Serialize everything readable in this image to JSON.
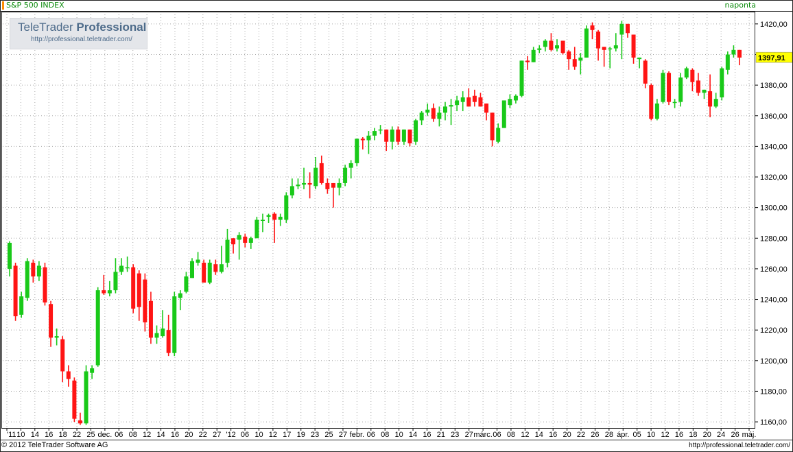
{
  "header": {
    "title": "S&P 500 INDEX",
    "frequency": "naponta"
  },
  "watermark": {
    "brand_prefix": "TeleTrader ",
    "brand_bold": "Professional",
    "url": "http://professional.teletrader.com/"
  },
  "footer": {
    "copyright": "© 2012  TeleTrader Software AG",
    "url": "http://professional.teletrader.com/"
  },
  "colors": {
    "up": "#19c919",
    "down": "#ff1414",
    "grid": "#a8a8a8",
    "frame": "#222222",
    "last_price_bg": "#ffff00"
  },
  "chart_data": {
    "type": "candlestick",
    "title": "S&P 500 INDEX",
    "ylim": [
      1156,
      1428
    ],
    "y_ticks": [
      "1160,00",
      "1180,00",
      "1200,00",
      "1220,00",
      "1240,00",
      "1260,00",
      "1280,00",
      "1300,00",
      "1320,00",
      "1340,00",
      "1360,00",
      "1380,00",
      "1400,00",
      "1420,00"
    ],
    "last_price": "1397,91",
    "last_price_value": 1397.91,
    "x_labels": [
      "'11",
      "10",
      "14",
      "16",
      "18",
      "22",
      "25",
      "dec.",
      "06",
      "08",
      "12",
      "14",
      "16",
      "20",
      "22",
      "27",
      "'12",
      "06",
      "10",
      "12",
      "17",
      "19",
      "23",
      "25",
      "27",
      "febr.",
      "06",
      "08",
      "10",
      "14",
      "16",
      "21",
      "23",
      "27",
      "márc.",
      "06",
      "08",
      "12",
      "14",
      "16",
      "20",
      "22",
      "26",
      "28",
      "ápr.",
      "05",
      "10",
      "12",
      "16",
      "18",
      "20",
      "24",
      "26",
      "máj."
    ],
    "grid": true,
    "candles": [
      {
        "o": 1260,
        "h": 1278,
        "l": 1255,
        "c": 1277
      },
      {
        "o": 1262,
        "h": 1264,
        "l": 1226,
        "c": 1229
      },
      {
        "o": 1230,
        "h": 1245,
        "l": 1228,
        "c": 1242
      },
      {
        "o": 1241,
        "h": 1267,
        "l": 1239,
        "c": 1265
      },
      {
        "o": 1264,
        "h": 1266,
        "l": 1251,
        "c": 1255
      },
      {
        "o": 1255,
        "h": 1265,
        "l": 1252,
        "c": 1262
      },
      {
        "o": 1261,
        "h": 1264,
        "l": 1236,
        "c": 1238
      },
      {
        "o": 1237,
        "h": 1239,
        "l": 1209,
        "c": 1215
      },
      {
        "o": 1215,
        "h": 1221,
        "l": 1210,
        "c": 1216
      },
      {
        "o": 1214,
        "h": 1216,
        "l": 1186,
        "c": 1193
      },
      {
        "o": 1193,
        "h": 1197,
        "l": 1183,
        "c": 1188
      },
      {
        "o": 1187,
        "h": 1189,
        "l": 1160,
        "c": 1162
      },
      {
        "o": 1161,
        "h": 1166,
        "l": 1158,
        "c": 1159
      },
      {
        "o": 1159,
        "h": 1197,
        "l": 1158,
        "c": 1193
      },
      {
        "o": 1192,
        "h": 1197,
        "l": 1188,
        "c": 1195
      },
      {
        "o": 1197,
        "h": 1248,
        "l": 1196,
        "c": 1246
      },
      {
        "o": 1246,
        "h": 1256,
        "l": 1243,
        "c": 1244
      },
      {
        "o": 1244,
        "h": 1252,
        "l": 1242,
        "c": 1246
      },
      {
        "o": 1246,
        "h": 1267,
        "l": 1244,
        "c": 1258
      },
      {
        "o": 1258,
        "h": 1267,
        "l": 1256,
        "c": 1262
      },
      {
        "o": 1261,
        "h": 1268,
        "l": 1258,
        "c": 1261
      },
      {
        "o": 1261,
        "h": 1263,
        "l": 1231,
        "c": 1234
      },
      {
        "o": 1257,
        "h": 1259,
        "l": 1226,
        "c": 1235
      },
      {
        "o": 1253,
        "h": 1257,
        "l": 1219,
        "c": 1225
      },
      {
        "o": 1239,
        "h": 1245,
        "l": 1211,
        "c": 1215
      },
      {
        "o": 1215,
        "h": 1223,
        "l": 1211,
        "c": 1218
      },
      {
        "o": 1216,
        "h": 1233,
        "l": 1215,
        "c": 1221
      },
      {
        "o": 1220,
        "h": 1230,
        "l": 1203,
        "c": 1205
      },
      {
        "o": 1205,
        "h": 1245,
        "l": 1203,
        "c": 1242
      },
      {
        "o": 1241,
        "h": 1246,
        "l": 1233,
        "c": 1244
      },
      {
        "o": 1245,
        "h": 1258,
        "l": 1244,
        "c": 1255
      },
      {
        "o": 1254,
        "h": 1267,
        "l": 1254,
        "c": 1265
      },
      {
        "o": 1264,
        "h": 1271,
        "l": 1262,
        "c": 1266
      },
      {
        "o": 1264,
        "h": 1266,
        "l": 1251,
        "c": 1251
      },
      {
        "o": 1251,
        "h": 1266,
        "l": 1250,
        "c": 1264
      },
      {
        "o": 1263,
        "h": 1266,
        "l": 1256,
        "c": 1258
      },
      {
        "o": 1258,
        "h": 1275,
        "l": 1257,
        "c": 1263
      },
      {
        "o": 1264,
        "h": 1286,
        "l": 1261,
        "c": 1279
      },
      {
        "o": 1280,
        "h": 1280,
        "l": 1270,
        "c": 1276
      },
      {
        "o": 1279,
        "h": 1284,
        "l": 1266,
        "c": 1282
      },
      {
        "o": 1281,
        "h": 1283,
        "l": 1274,
        "c": 1277
      },
      {
        "o": 1277,
        "h": 1281,
        "l": 1273,
        "c": 1280
      },
      {
        "o": 1280,
        "h": 1294,
        "l": 1280,
        "c": 1292
      },
      {
        "o": 1292,
        "h": 1296,
        "l": 1284,
        "c": 1292
      },
      {
        "o": 1294,
        "h": 1296,
        "l": 1290,
        "c": 1295
      },
      {
        "o": 1296,
        "h": 1297,
        "l": 1277,
        "c": 1292
      },
      {
        "o": 1292,
        "h": 1296,
        "l": 1288,
        "c": 1294
      },
      {
        "o": 1292,
        "h": 1310,
        "l": 1290,
        "c": 1308
      },
      {
        "o": 1308,
        "h": 1319,
        "l": 1306,
        "c": 1314
      },
      {
        "o": 1314,
        "h": 1319,
        "l": 1312,
        "c": 1315
      },
      {
        "o": 1315,
        "h": 1326,
        "l": 1312,
        "c": 1316
      },
      {
        "o": 1316,
        "h": 1323,
        "l": 1306,
        "c": 1315
      },
      {
        "o": 1314,
        "h": 1333,
        "l": 1312,
        "c": 1326
      },
      {
        "o": 1329,
        "h": 1334,
        "l": 1315,
        "c": 1316
      },
      {
        "o": 1316,
        "h": 1319,
        "l": 1309,
        "c": 1312
      },
      {
        "o": 1316,
        "h": 1316,
        "l": 1300,
        "c": 1313
      },
      {
        "o": 1313,
        "h": 1319,
        "l": 1308,
        "c": 1316
      },
      {
        "o": 1316,
        "h": 1328,
        "l": 1314,
        "c": 1326
      },
      {
        "o": 1326,
        "h": 1331,
        "l": 1319,
        "c": 1329
      },
      {
        "o": 1329,
        "h": 1345,
        "l": 1327,
        "c": 1345
      },
      {
        "o": 1345,
        "h": 1346,
        "l": 1338,
        "c": 1344
      },
      {
        "o": 1344,
        "h": 1350,
        "l": 1335,
        "c": 1347
      },
      {
        "o": 1347,
        "h": 1352,
        "l": 1344,
        "c": 1350
      },
      {
        "o": 1351,
        "h": 1354,
        "l": 1348,
        "c": 1351
      },
      {
        "o": 1351,
        "h": 1351,
        "l": 1337,
        "c": 1343
      },
      {
        "o": 1343,
        "h": 1353,
        "l": 1338,
        "c": 1351
      },
      {
        "o": 1351,
        "h": 1353,
        "l": 1341,
        "c": 1343
      },
      {
        "o": 1343,
        "h": 1351,
        "l": 1341,
        "c": 1351
      },
      {
        "o": 1351,
        "h": 1351,
        "l": 1340,
        "c": 1342
      },
      {
        "o": 1343,
        "h": 1358,
        "l": 1341,
        "c": 1357
      },
      {
        "o": 1357,
        "h": 1363,
        "l": 1354,
        "c": 1362
      },
      {
        "o": 1362,
        "h": 1368,
        "l": 1360,
        "c": 1364
      },
      {
        "o": 1365,
        "h": 1368,
        "l": 1356,
        "c": 1358
      },
      {
        "o": 1358,
        "h": 1366,
        "l": 1353,
        "c": 1362
      },
      {
        "o": 1362,
        "h": 1369,
        "l": 1357,
        "c": 1366
      },
      {
        "o": 1366,
        "h": 1371,
        "l": 1354,
        "c": 1367
      },
      {
        "o": 1367,
        "h": 1373,
        "l": 1363,
        "c": 1370
      },
      {
        "o": 1369,
        "h": 1376,
        "l": 1363,
        "c": 1372
      },
      {
        "o": 1372,
        "h": 1378,
        "l": 1366,
        "c": 1366
      },
      {
        "o": 1373,
        "h": 1377,
        "l": 1366,
        "c": 1369
      },
      {
        "o": 1372,
        "h": 1375,
        "l": 1366,
        "c": 1366
      },
      {
        "o": 1368,
        "h": 1368,
        "l": 1357,
        "c": 1362
      },
      {
        "o": 1362,
        "h": 1362,
        "l": 1340,
        "c": 1344
      },
      {
        "o": 1343,
        "h": 1355,
        "l": 1342,
        "c": 1352
      },
      {
        "o": 1352,
        "h": 1370,
        "l": 1352,
        "c": 1370
      },
      {
        "o": 1367,
        "h": 1374,
        "l": 1365,
        "c": 1371
      },
      {
        "o": 1370,
        "h": 1374,
        "l": 1368,
        "c": 1373
      },
      {
        "o": 1373,
        "h": 1396,
        "l": 1372,
        "c": 1396
      },
      {
        "o": 1396,
        "h": 1399,
        "l": 1390,
        "c": 1395
      },
      {
        "o": 1395,
        "h": 1405,
        "l": 1395,
        "c": 1403
      },
      {
        "o": 1403,
        "h": 1406,
        "l": 1401,
        "c": 1404
      },
      {
        "o": 1405,
        "h": 1410,
        "l": 1402,
        "c": 1409
      },
      {
        "o": 1409,
        "h": 1414,
        "l": 1402,
        "c": 1403
      },
      {
        "o": 1404,
        "h": 1410,
        "l": 1402,
        "c": 1406
      },
      {
        "o": 1409,
        "h": 1409,
        "l": 1400,
        "c": 1401
      },
      {
        "o": 1402,
        "h": 1403,
        "l": 1390,
        "c": 1397
      },
      {
        "o": 1397,
        "h": 1405,
        "l": 1390,
        "c": 1392
      },
      {
        "o": 1396,
        "h": 1401,
        "l": 1387,
        "c": 1398
      },
      {
        "o": 1398,
        "h": 1419,
        "l": 1398,
        "c": 1417
      },
      {
        "o": 1419,
        "h": 1421,
        "l": 1410,
        "c": 1416
      },
      {
        "o": 1415,
        "h": 1416,
        "l": 1396,
        "c": 1404
      },
      {
        "o": 1405,
        "h": 1405,
        "l": 1392,
        "c": 1403
      },
      {
        "o": 1404,
        "h": 1405,
        "l": 1391,
        "c": 1404
      },
      {
        "o": 1404,
        "h": 1414,
        "l": 1402,
        "c": 1406
      },
      {
        "o": 1413,
        "h": 1422,
        "l": 1397,
        "c": 1420
      },
      {
        "o": 1420,
        "h": 1420,
        "l": 1411,
        "c": 1414
      },
      {
        "o": 1413,
        "h": 1413,
        "l": 1394,
        "c": 1398
      },
      {
        "o": 1397,
        "h": 1398,
        "l": 1391,
        "c": 1398
      },
      {
        "o": 1396,
        "h": 1397,
        "l": 1378,
        "c": 1381
      },
      {
        "o": 1380,
        "h": 1381,
        "l": 1357,
        "c": 1358
      },
      {
        "o": 1358,
        "h": 1371,
        "l": 1357,
        "c": 1368
      },
      {
        "o": 1369,
        "h": 1390,
        "l": 1368,
        "c": 1388
      },
      {
        "o": 1388,
        "h": 1389,
        "l": 1367,
        "c": 1369
      },
      {
        "o": 1369,
        "h": 1371,
        "l": 1365,
        "c": 1369
      },
      {
        "o": 1369,
        "h": 1388,
        "l": 1366,
        "c": 1385
      },
      {
        "o": 1385,
        "h": 1392,
        "l": 1384,
        "c": 1391
      },
      {
        "o": 1390,
        "h": 1391,
        "l": 1376,
        "c": 1382
      },
      {
        "o": 1383,
        "h": 1388,
        "l": 1373,
        "c": 1375
      },
      {
        "o": 1375,
        "h": 1377,
        "l": 1371,
        "c": 1377
      },
      {
        "o": 1376,
        "h": 1387,
        "l": 1359,
        "c": 1366
      },
      {
        "o": 1366,
        "h": 1375,
        "l": 1365,
        "c": 1371
      },
      {
        "o": 1372,
        "h": 1392,
        "l": 1370,
        "c": 1391
      },
      {
        "o": 1390,
        "h": 1402,
        "l": 1387,
        "c": 1400
      },
      {
        "o": 1400,
        "h": 1406,
        "l": 1398,
        "c": 1403
      },
      {
        "o": 1403,
        "h": 1403,
        "l": 1393,
        "c": 1398
      }
    ]
  }
}
